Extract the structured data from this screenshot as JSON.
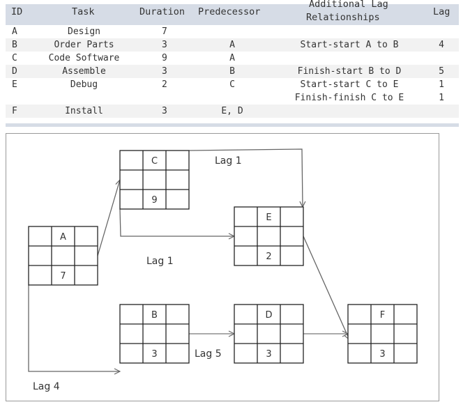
{
  "table": {
    "headers": {
      "id": "ID",
      "task": "Task",
      "duration": "Duration",
      "predecessor": "Predecessor",
      "relationships_line1": "Additional Lag",
      "relationships_line2": "Relationships",
      "lag": "Lag"
    },
    "rows": [
      {
        "id": "A",
        "task": "Design",
        "duration": "7",
        "predecessor": "",
        "relationship": "",
        "lag": ""
      },
      {
        "id": "B",
        "task": "Order Parts",
        "duration": "3",
        "predecessor": "A",
        "relationship": "Start-start A to B",
        "lag": "4"
      },
      {
        "id": "C",
        "task": "Code Software",
        "duration": "9",
        "predecessor": "A",
        "relationship": "",
        "lag": ""
      },
      {
        "id": "D",
        "task": "Assemble",
        "duration": "3",
        "predecessor": "B",
        "relationship": "Finish-start B to D",
        "lag": "5"
      },
      {
        "id": "E",
        "task": "Debug",
        "duration": "2",
        "predecessor": "C",
        "relationship": "Start-start C to E",
        "lag": "1"
      },
      {
        "id": "",
        "task": "",
        "duration": "",
        "predecessor": "",
        "relationship": "Finish-finish C to E",
        "lag": "1"
      },
      {
        "id": "F",
        "task": "Install",
        "duration": "3",
        "predecessor": "E, D",
        "relationship": "",
        "lag": ""
      }
    ]
  },
  "diagram": {
    "nodes": [
      {
        "id": "A",
        "duration": "7"
      },
      {
        "id": "B",
        "duration": "3"
      },
      {
        "id": "C",
        "duration": "9"
      },
      {
        "id": "D",
        "duration": "3"
      },
      {
        "id": "E",
        "duration": "2"
      },
      {
        "id": "F",
        "duration": "3"
      }
    ],
    "edges": [
      {
        "from": "A",
        "to": "C",
        "type": "finish-start",
        "label": ""
      },
      {
        "from": "A",
        "to": "B",
        "type": "start-start",
        "label": "Lag 4"
      },
      {
        "from": "C",
        "to": "E",
        "type": "start-start",
        "label": "Lag 1"
      },
      {
        "from": "C",
        "to": "E",
        "type": "finish-finish",
        "label": "Lag 1"
      },
      {
        "from": "B",
        "to": "D",
        "type": "finish-start",
        "label": "Lag 5"
      },
      {
        "from": "D",
        "to": "F",
        "type": "finish-start",
        "label": ""
      },
      {
        "from": "E",
        "to": "F",
        "type": "finish-start",
        "label": ""
      }
    ]
  }
}
